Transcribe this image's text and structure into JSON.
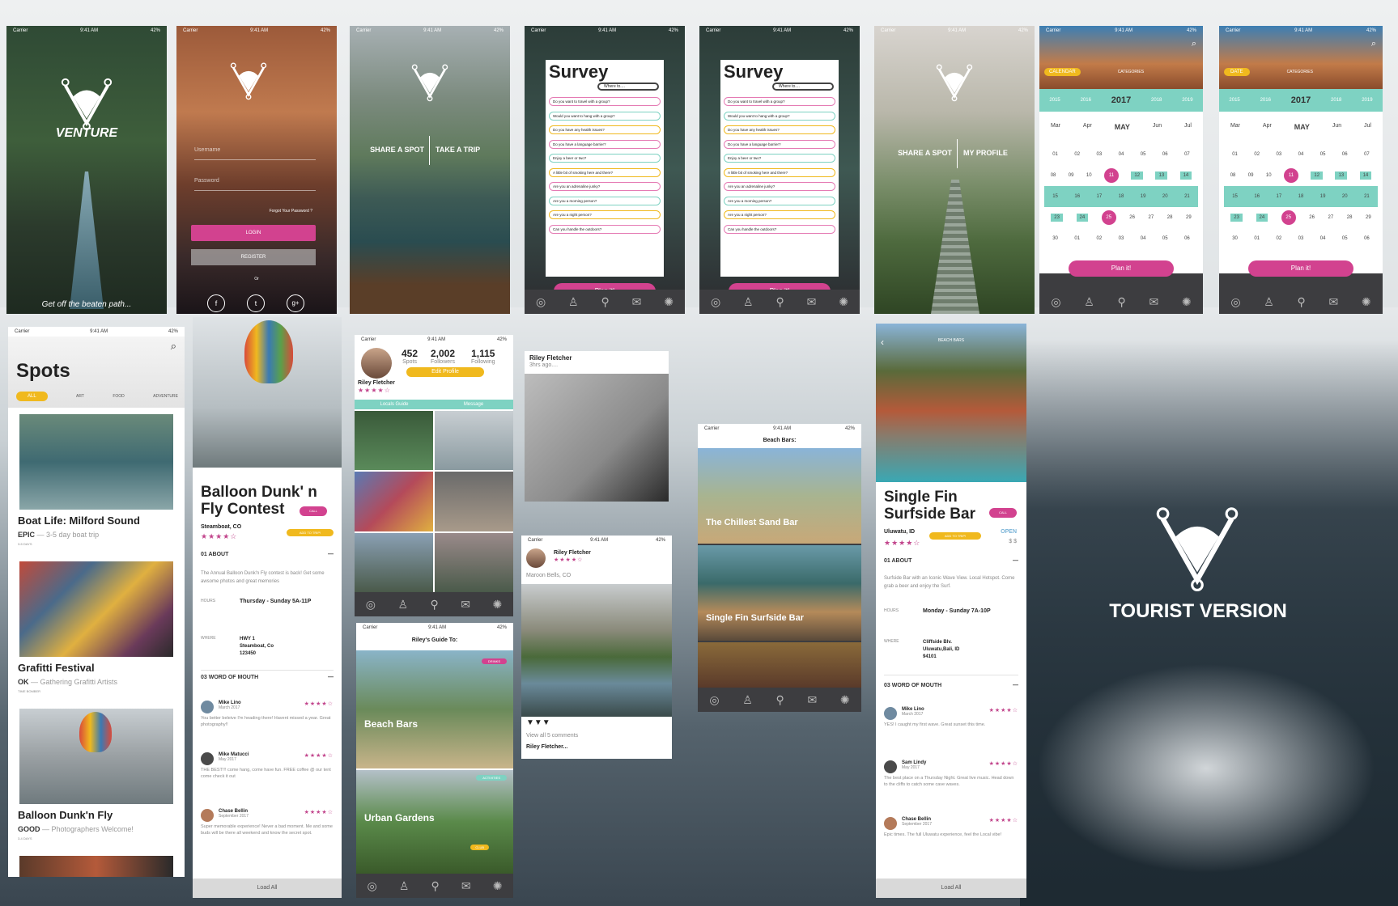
{
  "colors": {
    "pink": "#d2428f",
    "gold": "#f0b91e",
    "teal": "#7ed2c2",
    "tabbar": "#3d3d40"
  },
  "status": {
    "carrier": "Carrier",
    "time": "9:41 AM",
    "battery": "42%"
  },
  "splash": {
    "title": "VENTURE",
    "tagline": "Get off the beaten path..."
  },
  "login": {
    "username": "Username",
    "password": "Password",
    "forgot": "Forgot Your Password ?",
    "login": "LOGIN",
    "register": "REGISTER",
    "or": "Or",
    "social": [
      "f",
      "t",
      "g+"
    ]
  },
  "choice1": {
    "left": "SHARE A SPOT",
    "right": "TAKE A TRIP"
  },
  "choice2": {
    "left": "SHARE A SPOT",
    "right": "MY PROFILE"
  },
  "survey": {
    "title": "Survey",
    "where": "Where to....",
    "questions": [
      "Do you want to travel with a group?",
      "Would you want to hang with a group?",
      "Do you have any health issues?",
      "Do you have a language barrier?",
      "Enjoy a beer or two?",
      "A little bit of smoking here and there?",
      "Are you an adrenaline junky?",
      "Are you a morning person?",
      "Are you a night person?",
      "Can you handle the outdoors?"
    ],
    "button": "Plan it!"
  },
  "calendar": {
    "tabs1": [
      "CALENDAR",
      "CATEGORIES"
    ],
    "tabs2": [
      "DATE",
      "CATEGORIES"
    ],
    "years": [
      "2015",
      "2016",
      "2017",
      "2018",
      "2019"
    ],
    "months": [
      "Mar",
      "Apr",
      "MAY",
      "Jun",
      "Jul"
    ],
    "rows": [
      [
        "01",
        "02",
        "03",
        "04",
        "05",
        "06",
        "07"
      ],
      [
        "08",
        "09",
        "10",
        "11",
        "12",
        "13",
        "14"
      ],
      [
        "15",
        "16",
        "17",
        "18",
        "19",
        "20",
        "21"
      ],
      [
        "23",
        "24",
        "25",
        "26",
        "27",
        "28",
        "29"
      ],
      [
        "30",
        "01",
        "02",
        "03",
        "04",
        "05",
        "06"
      ]
    ],
    "button": "Plan it!"
  },
  "spots": {
    "title": "Spots",
    "filters": [
      "ALL",
      "ART",
      "FOOD",
      "ADVENTURE"
    ],
    "items": [
      {
        "title": "Boat Life: Milford Sound",
        "rating": "EPIC",
        "desc": "3-5 day boat trip",
        "meta": "3-5 DAYS"
      },
      {
        "title": "Grafitti Festival",
        "rating": "OK",
        "desc": "Gathering Grafitti Artists",
        "meta": "TIME BOMBER"
      },
      {
        "title": "Balloon Dunk'n Fly",
        "rating": "GOOD",
        "desc": "Photographers Welcome!",
        "meta": "3-4 DAYS"
      }
    ]
  },
  "balloon": {
    "title": "Balloon Dunk' n Fly Contest",
    "call": "CALL",
    "loc": "Steamboat, CO",
    "addtrip": "ADD TO TRIP!",
    "stars": "★★★★☆",
    "about": "01 ABOUT",
    "aboutText": "The Annual Balloon Dunk'n Fly contest is back! Get some awsome photos and great memories",
    "hoursLabel": "HOURS",
    "hours": "Thursday - Sunday 5A-11P",
    "whereLabel": "WHERE",
    "where": [
      "HWY 1",
      "Steamboat, Co",
      "123450"
    ],
    "wom": "03 WORD OF MOUTH",
    "reviews": [
      {
        "name": "Mike Lino",
        "date": "March 2017",
        "text": "You better beleive I'm heading there! Havent missed a year. Great photography!!"
      },
      {
        "name": "Mike Matucci",
        "date": "May 2017",
        "text": "THE BEST!!! come hang, come have fun. FREE coffee @ our tent come check it out"
      },
      {
        "name": "Chase Bellin",
        "date": "September 2017",
        "text": "Super memorable experience! Never a bad moment. Me and some buds will be there all weekend and know the secret spot."
      }
    ],
    "load": "Load All"
  },
  "profile": {
    "spots": "452",
    "spotsLabel": "Spots",
    "followers": "2,002",
    "followersLabel": "Followers",
    "following": "1,115",
    "followingLabel": "Following",
    "name": "Riley Fletcher",
    "edit": "Edit Profile",
    "tabs": [
      "Locals Guide",
      "Message"
    ]
  },
  "post1": {
    "name": "Riley Fletcher",
    "time": "3hrs ago...."
  },
  "post2": {
    "name": "Riley Fletcher",
    "loc": "Maroon Bells, CO",
    "comments": "View all 5 comments",
    "foot": "Riley Fletcher..."
  },
  "guide": {
    "title": "Riley's Guide To:",
    "items": [
      "Beach Bars",
      "Urban Gardens"
    ],
    "tags": [
      "DRINKS",
      "ACTIVITIES",
      "CLUB"
    ]
  },
  "beachbars": {
    "title": "Beach Bars:",
    "items": [
      "The Chillest Sand Bar",
      "Single Fin Surfside Bar"
    ]
  },
  "singlefin": {
    "top": "BEACH BARS",
    "title": "Single Fin Surfside Bar",
    "call": "CALL",
    "loc": "Uluwatu, ID",
    "open": "OPEN",
    "price": "$ $",
    "addtrip": "ADD TO TRIP!",
    "about": "01 ABOUT",
    "aboutText": "Surfside Bar with an Iconic Wave View. Local Hotspot. Come grab a beer and enjoy the Surf.",
    "hoursLabel": "HOURS",
    "hours": "Monday - Sunday 7A-10P",
    "whereLabel": "WHERE",
    "where": [
      "Cliffside Blv.",
      "Uluwatu,Bali, ID",
      "94101"
    ],
    "wom": "03 WORD OF MOUTH",
    "reviews": [
      {
        "name": "Mike Lino",
        "date": "March 2017",
        "text": "YES! I caught my first wave. Great sunset this time."
      },
      {
        "name": "Sam Lindy",
        "date": "May 2017",
        "text": "The best place on a Thursday Night. Great live music. Head down to the cliffs to catch some cave waves."
      },
      {
        "name": "Chase Bellin",
        "date": "September 2017",
        "text": "Epic times. The full Uluwatu experience, feel the Local vibe!"
      }
    ],
    "load": "Load All"
  },
  "brand": {
    "title": "TOURIST VERSION"
  },
  "icons": [
    "globe-icon",
    "person-icon",
    "pin-icon",
    "mail-icon",
    "aperture-icon"
  ]
}
